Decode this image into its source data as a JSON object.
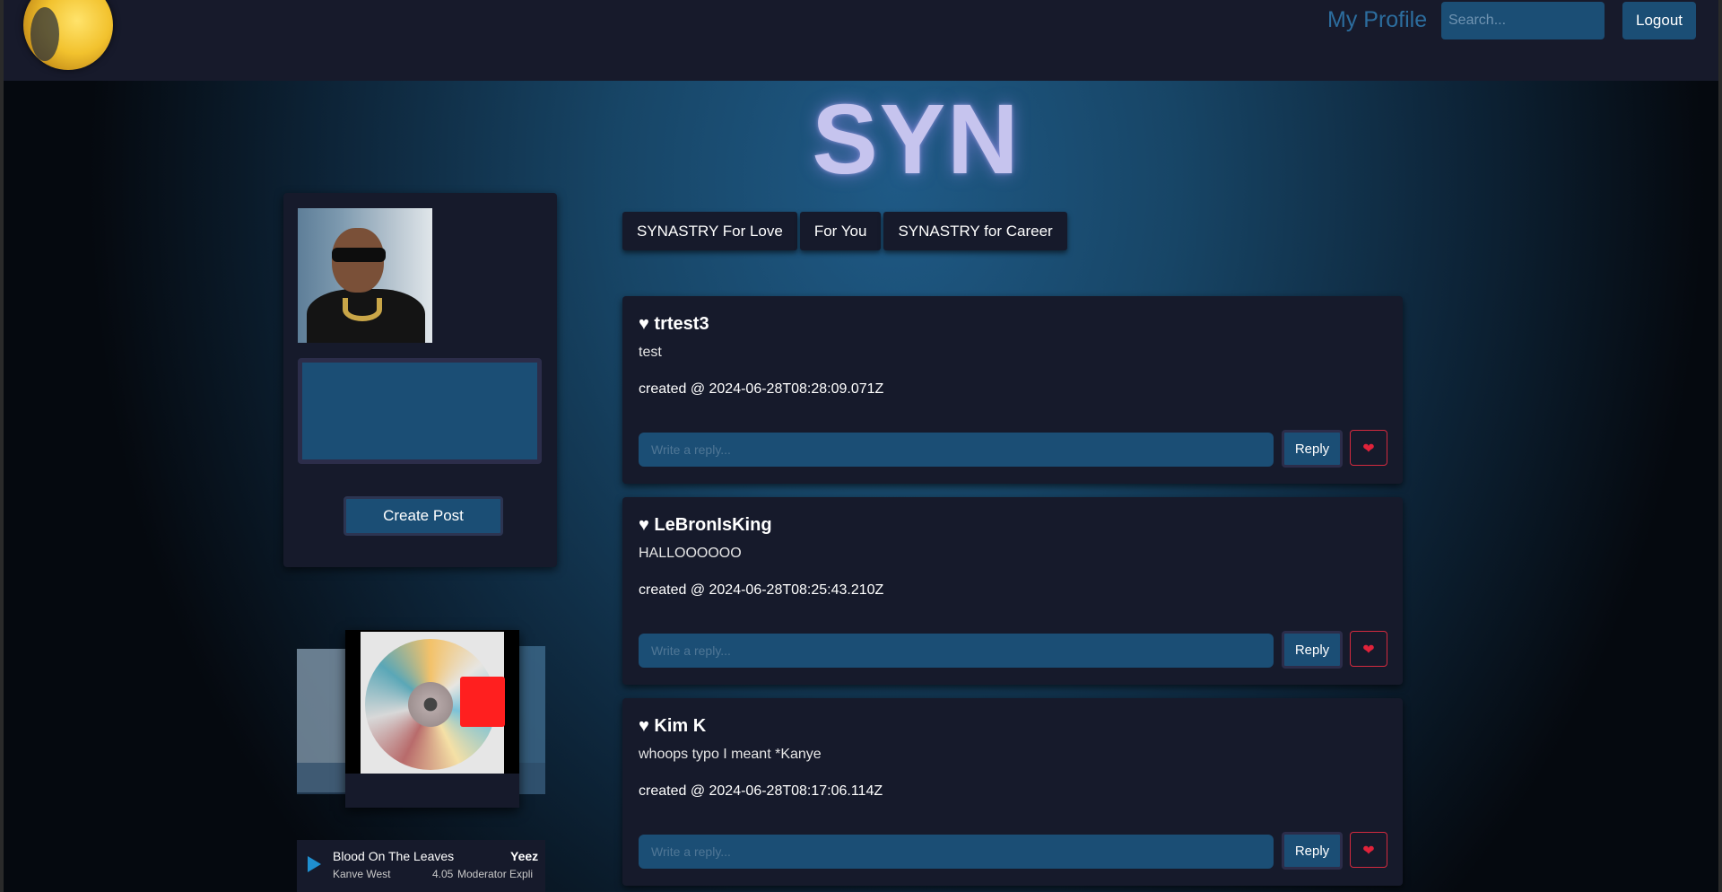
{
  "nav": {
    "profile_label": "My Profile",
    "search_placeholder": "Search...",
    "logout_label": "Logout"
  },
  "site": {
    "title": "SYN"
  },
  "composer": {
    "create_label": "Create Post"
  },
  "music": {
    "track_title": "Blood On The Leaves",
    "artist": "Kanve West",
    "album": "Yeez",
    "duration": "4.05",
    "tags": "Moderator Expli"
  },
  "tabs": [
    {
      "label": "SYNASTRY For Love"
    },
    {
      "label": "For You"
    },
    {
      "label": "SYNASTRY for Career"
    }
  ],
  "posts": [
    {
      "author": "♥ trtest3",
      "content": "test",
      "created": "created @ 2024-06-28T08:28:09.071Z",
      "reply_placeholder": "Write a reply...",
      "reply_label": "Reply",
      "like_glyph": "❤"
    },
    {
      "author": "♥ LeBronIsKing",
      "content": "HALLOOOOOO",
      "created": "created @ 2024-06-28T08:25:43.210Z",
      "reply_placeholder": "Write a reply...",
      "reply_label": "Reply",
      "like_glyph": "❤"
    },
    {
      "author": "♥ Kim K",
      "content": "whoops typo I meant *Kanye",
      "created": "created @ 2024-06-28T08:17:06.114Z",
      "reply_placeholder": "Write a reply...",
      "reply_label": "Reply",
      "like_glyph": "❤"
    }
  ],
  "colors": {
    "navbar_bg": "#171a2b",
    "card_bg": "#161a2b",
    "input_bg": "#1b4e75",
    "title_color": "#c6c4ee",
    "like_red": "#e0223a"
  }
}
